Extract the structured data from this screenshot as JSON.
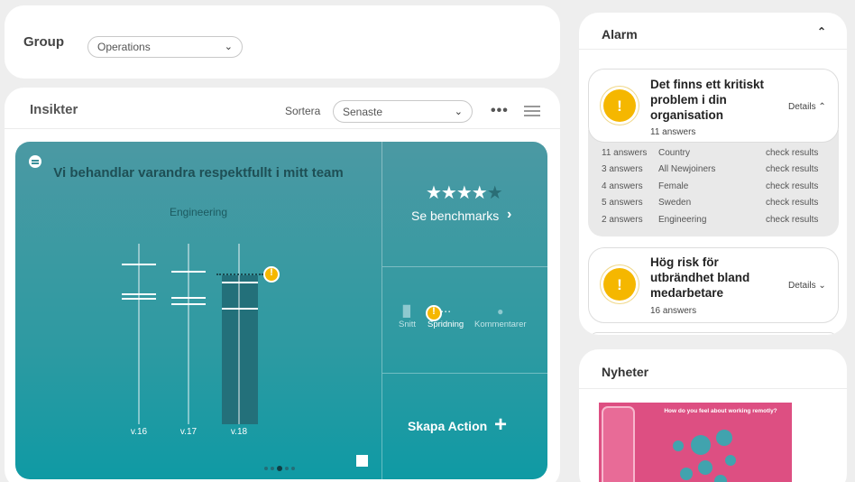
{
  "group": {
    "label": "Group",
    "selected": "Operations"
  },
  "insights": {
    "title": "Insikter",
    "sort_label": "Sortera",
    "sort_selected": "Senaste",
    "question": "Vi behandlar varandra respektfullt i mitt team",
    "question_sub": "Engineering",
    "weeks": [
      "v.16",
      "v.17",
      "v.18"
    ],
    "benchmark_rating": 3.5,
    "benchmark_link": "Se benchmarks",
    "tabs": [
      "Snitt",
      "Spridning",
      "Kommentarer"
    ],
    "action_label": "Skapa Action",
    "pager": {
      "pages": 5,
      "current": 3
    },
    "colors": {
      "panel": "#2e9aa2",
      "warning": "#f5b700"
    }
  },
  "alarm": {
    "title": "Alarm",
    "alerts": [
      {
        "title": "Det finns ett kritiskt problem i din organisation",
        "count": "11 answers",
        "details": "Details"
      },
      {
        "title": "Hög risk för utbrändhet bland medarbetare",
        "count": "16 answers",
        "details": "Details"
      }
    ],
    "rows": [
      {
        "answers": "11 answers",
        "group": "Country",
        "action": "check results"
      },
      {
        "answers": "3 answers",
        "group": "All Newjoiners",
        "action": "check results"
      },
      {
        "answers": "4 answers",
        "group": "Female",
        "action": "check results"
      },
      {
        "answers": "5 answers",
        "group": "Sweden",
        "action": "check results"
      },
      {
        "answers": "2 answers",
        "group": "Engineering",
        "action": "check results"
      }
    ]
  },
  "news": {
    "title": "Nyheter",
    "image_headline": "How do you feel about working remotly?"
  }
}
